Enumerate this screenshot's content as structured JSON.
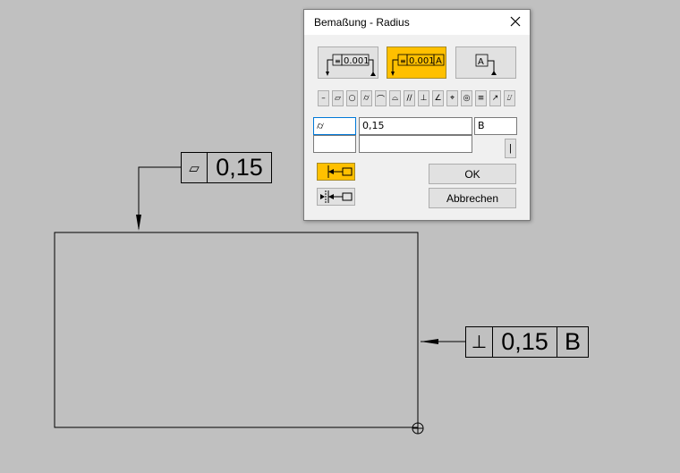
{
  "dialog": {
    "title": "Bemaßung - Radius",
    "symbols": [
      "–",
      "▱",
      "○",
      "⌭",
      "⌒",
      "⌓",
      "//",
      "⊥",
      "∠",
      "⌖",
      "◎",
      "≡",
      "↗",
      "⌰"
    ],
    "fields": {
      "symbol_value": "⌭",
      "tolerance_value": "0,15",
      "datum_value": "B",
      "second_symbol_value": "",
      "second_tolerance_value": "",
      "extra_button_label": "|"
    },
    "ok_label": "OK",
    "cancel_label": "Abbrechen",
    "frame_preview_label": "0.001",
    "frame_datum_label": "A"
  },
  "drawing": {
    "frame_top": {
      "symbol": "▱",
      "value": "0,15"
    },
    "frame_right": {
      "symbol": "⊥",
      "value": "0,15",
      "datum": "B"
    }
  },
  "colors": {
    "accent": "#ffc000",
    "background": "#c0c0c0"
  }
}
